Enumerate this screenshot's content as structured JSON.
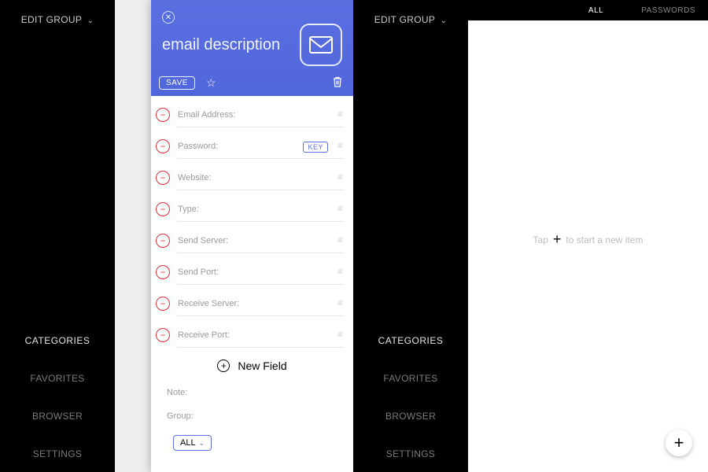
{
  "sidebar": {
    "edit_group": "EDIT GROUP",
    "categories": "CATEGORIES",
    "items": [
      "FAVORITES",
      "BROWSER",
      "SETTINGS"
    ]
  },
  "right": {
    "tabs": {
      "all": "ALL",
      "passwords": "PASSWORDS"
    },
    "hint_pre": "Tap",
    "hint_post": "to start a new item"
  },
  "card": {
    "title": "email description",
    "save": "SAVE",
    "key": "KEY",
    "fields": [
      "Email Address:",
      "Password:",
      "Website:",
      "Type:",
      "Send Server:",
      "Send Port:",
      "Receive Server:",
      "Receive Port:"
    ],
    "new_field": "New Field",
    "note": "Note:",
    "group": "Group:",
    "group_value": "ALL"
  }
}
